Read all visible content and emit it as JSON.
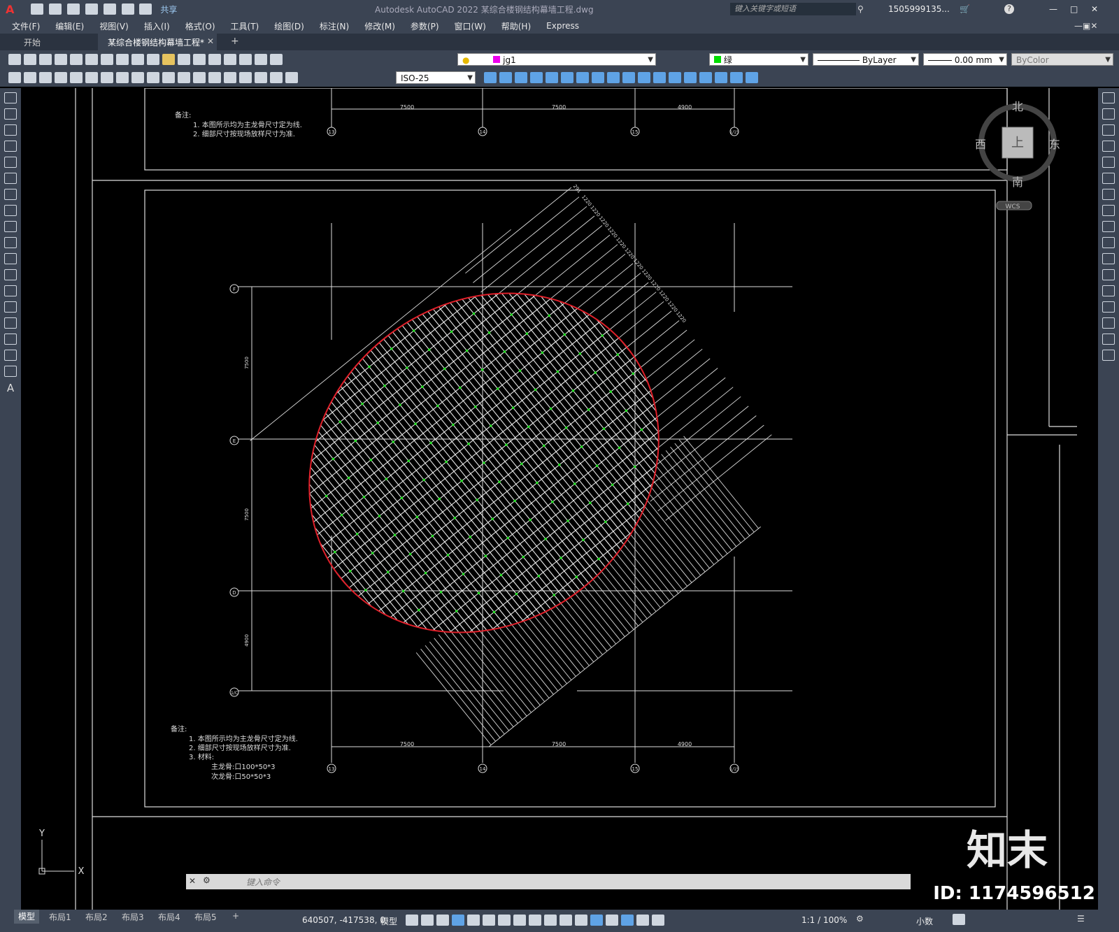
{
  "window": {
    "title": "Autodesk AutoCAD 2022    某综合楼钢结构幕墙工程.dwg",
    "search_placeholder": "键入关键字或短语",
    "user": "1505999135...",
    "share_label": "共享"
  },
  "menu": [
    "文件(F)",
    "编辑(E)",
    "视图(V)",
    "插入(I)",
    "格式(O)",
    "工具(T)",
    "绘图(D)",
    "标注(N)",
    "修改(M)",
    "参数(P)",
    "窗口(W)",
    "帮助(H)",
    "Express"
  ],
  "tabs": {
    "start": "开始",
    "active": "某综合楼钢结构幕墙工程*",
    "add": "+"
  },
  "toolbar": {
    "layer": "jg1",
    "color": "绿",
    "linetype": "ByLayer",
    "lineweight": "0.00 mm",
    "plotstyle": "ByColor",
    "dimstyle": "ISO-25"
  },
  "viewcube": {
    "north": "北",
    "south": "南",
    "east": "东",
    "west": "西",
    "top": "上",
    "wcs": "WCS"
  },
  "drawing": {
    "notes_title": "备注:",
    "top_notes": [
      "1. 本图所示均为主龙骨尺寸定为线.",
      "2. 细部尺寸按现场放样尺寸为准."
    ],
    "bottom_notes": [
      "1. 本图所示均为主龙骨尺寸定为线.",
      "2. 细部尺寸按现场放样尺寸为准.",
      "3. 材料:"
    ],
    "materials": [
      "主龙骨:口100*50*3",
      "次龙骨:口50*50*3"
    ],
    "col_axes": [
      "13",
      "14",
      "15",
      "1/15"
    ],
    "row_axes": [
      "F",
      "E",
      "D",
      "1/C"
    ],
    "col_dims": [
      "7500",
      "7500",
      "4900"
    ],
    "row_dims": [
      "7500",
      "7500",
      "4900"
    ],
    "diag_dims": [
      "291",
      "1220",
      "1220",
      "1220",
      "1220",
      "1220",
      "1220",
      "1220",
      "1220",
      "1220",
      "1220",
      "1220",
      "1220"
    ]
  },
  "ucs": {
    "x": "X",
    "y": "Y"
  },
  "command": {
    "placeholder": "键入命令"
  },
  "layout_tabs": [
    "模型",
    "布局1",
    "布局2",
    "布局3",
    "布局4",
    "布局5",
    "+"
  ],
  "status": {
    "coords": "640507, -417538, 0",
    "model": "模型",
    "scale": "1:1 / 100%",
    "units": "小数"
  },
  "watermark": {
    "logo": "知末",
    "id": "ID: 1174596512"
  },
  "colors": {
    "accent": "#3a8ee6",
    "ellipse": "#e0202a",
    "grid_dot": "#22dd22"
  }
}
